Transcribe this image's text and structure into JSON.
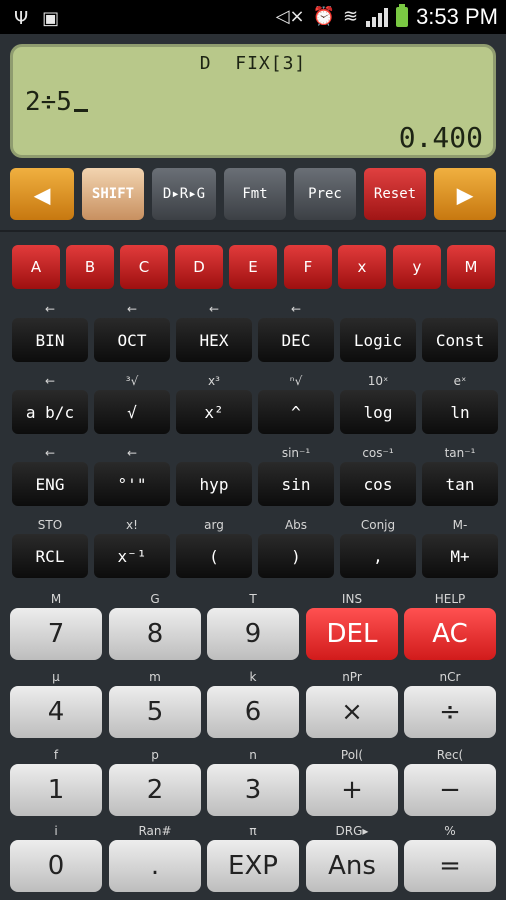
{
  "status_bar": {
    "time": "3:53 PM",
    "icons": [
      "usb-icon",
      "image-icon",
      "mute-icon",
      "alarm-icon",
      "wifi-icon",
      "signal-icon",
      "battery-icon"
    ]
  },
  "display": {
    "mode": "D  FIX[3]",
    "expression": "2÷5",
    "result": "0.400"
  },
  "function_row": {
    "left_arrow": "◀",
    "shift": "SHIFT",
    "drg": "D▸R▸G",
    "fmt": "Fmt",
    "prec": "Prec",
    "reset": "Reset",
    "right_arrow": "▶"
  },
  "letters": [
    "A",
    "B",
    "C",
    "D",
    "E",
    "F",
    "x",
    "y",
    "M"
  ],
  "row1_labels": [
    "←",
    "←",
    "←",
    "←",
    "",
    ""
  ],
  "row1": [
    "BIN",
    "OCT",
    "HEX",
    "DEC",
    "Logic",
    "Const"
  ],
  "row2_labels": [
    "←",
    "³√",
    "x³",
    "ⁿ√",
    "10ˣ",
    "eˣ"
  ],
  "row2": [
    "a b/c",
    "√",
    "x²",
    "^",
    "log",
    "ln"
  ],
  "row3_labels": [
    "←",
    "←",
    "",
    "sin⁻¹",
    "cos⁻¹",
    "tan⁻¹"
  ],
  "row3": [
    "ENG",
    "°'\"",
    "hyp",
    "sin",
    "cos",
    "tan"
  ],
  "row4_labels": [
    "STO",
    "x!",
    "arg",
    "Abs",
    "Conjg",
    "M-"
  ],
  "row4": [
    "RCL",
    "x⁻¹",
    "(",
    ")",
    ",",
    "M+"
  ],
  "pad_labels": [
    [
      "M",
      "G",
      "T",
      "INS",
      "HELP"
    ],
    [
      "μ",
      "m",
      "k",
      "nPr",
      "nCr"
    ],
    [
      "f",
      "p",
      "n",
      "Pol(",
      "Rec("
    ],
    [
      "i",
      "Ran#",
      "π",
      "DRG▸",
      "%"
    ]
  ],
  "pad": [
    [
      "7",
      "8",
      "9",
      "DEL",
      "AC"
    ],
    [
      "4",
      "5",
      "6",
      "×",
      "÷"
    ],
    [
      "1",
      "2",
      "3",
      "+",
      "−"
    ],
    [
      "0",
      ".",
      "EXP",
      "Ans",
      "="
    ]
  ],
  "colors": {
    "background": "#2b3035",
    "lcd": "#b8c88a",
    "orange_key": "#e39a25",
    "red_key": "#d11b1b",
    "light_key": "#e0e0e0",
    "dark_key": "#141414"
  }
}
